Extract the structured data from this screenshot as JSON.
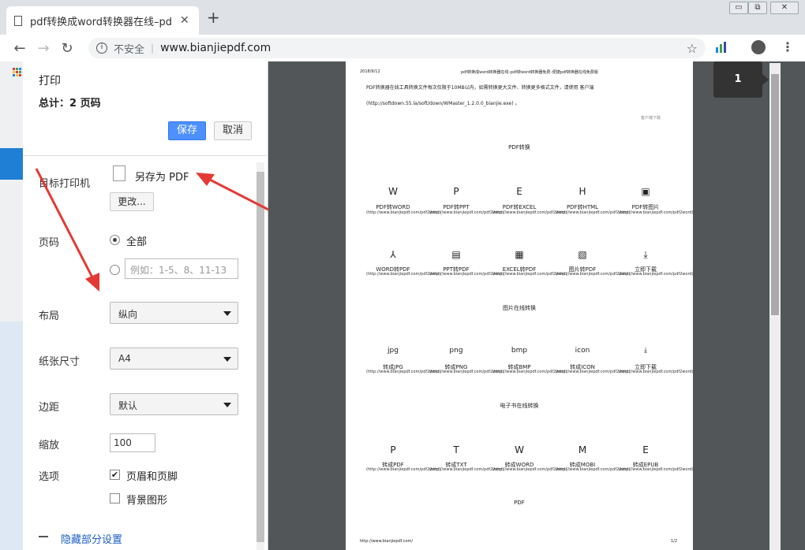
{
  "tab": {
    "title": "pdf转换成word转换器在线–pdf转"
  },
  "window": {
    "minimize": "▭",
    "restore": "⧉",
    "close": "✕"
  },
  "toolbar": {
    "insecure": "不安全",
    "url": "www.bianjiepdf.com"
  },
  "print": {
    "title": "打印",
    "total": "总计：2 页码",
    "save": "保存",
    "cancel": "取消",
    "dest_label": "目标打印机",
    "dest_value": "另存为 PDF",
    "change": "更改...",
    "pages_label": "页码",
    "pages_all": "全部",
    "pages_placeholder": "例如：1-5、8、11-13",
    "layout_label": "布局",
    "layout_value": "纵向",
    "paper_label": "纸张尺寸",
    "paper_value": "A4",
    "margin_label": "边距",
    "margin_value": "默认",
    "scale_label": "缩放",
    "scale_value": "100",
    "options_label": "选项",
    "opt_header": "页眉和页脚",
    "opt_bg": "背景图形",
    "less": "隐藏部分设置"
  },
  "preview": {
    "page_badge": "1",
    "date": "2018/9/12",
    "header_center": "pdf转换成word转换器在线–pdf转word转换器免费–便捷pdf转换器在线免费版",
    "notice": "PDF转换器在线工具转换文件每次仅限于10MB以内，如需转换更大文件、转换更多格式文件，请使用 客户端",
    "notice_url": "(http://softdown.55.la/soft/down/WMaster_1.2.0.0_bianjie.exe) 。",
    "client_dl": "客户端下载",
    "sec1": "PDF转换",
    "row1": [
      {
        "g": "W",
        "c": "PDF转WORD"
      },
      {
        "g": "P",
        "c": "PDF转PPT"
      },
      {
        "g": "E",
        "c": "PDF转EXCEL"
      },
      {
        "g": "H",
        "c": "PDF转HTML"
      },
      {
        "g": "▣",
        "c": "PDF转图片"
      }
    ],
    "row2": [
      {
        "g": "⅄",
        "c": "WORD转PDF"
      },
      {
        "g": "▤",
        "c": "PPT转PDF"
      },
      {
        "g": "▦",
        "c": "EXCEL转PDF"
      },
      {
        "g": "▧",
        "c": "图片转PDF"
      },
      {
        "g": "⤓",
        "c": "立即下载"
      }
    ],
    "sec2": "图片在线转换",
    "row3": [
      {
        "g": "jpg",
        "c": "转成JPG"
      },
      {
        "g": "png",
        "c": "转成PNG"
      },
      {
        "g": "bmp",
        "c": "转成BMP"
      },
      {
        "g": "icon",
        "c": "转成ICON"
      },
      {
        "g": "⤓",
        "c": "立即下载"
      }
    ],
    "sec3": "电子书在线转换",
    "row4": [
      {
        "g": "P",
        "c": "转成PDF"
      },
      {
        "g": "T",
        "c": "转成TXT"
      },
      {
        "g": "W",
        "c": "转成WORD"
      },
      {
        "g": "M",
        "c": "转成MOBI"
      },
      {
        "g": "E",
        "c": "转成EPUB"
      }
    ],
    "sec4": "PDF",
    "link_text": "(http://www.bianjiepdf.com/pdf2word)",
    "footer_url": "http://www.bianjiepdf.com/",
    "footer_page": "1/2"
  },
  "colors": {
    "accent": "#4d90fe",
    "arrow": "#e53935"
  }
}
